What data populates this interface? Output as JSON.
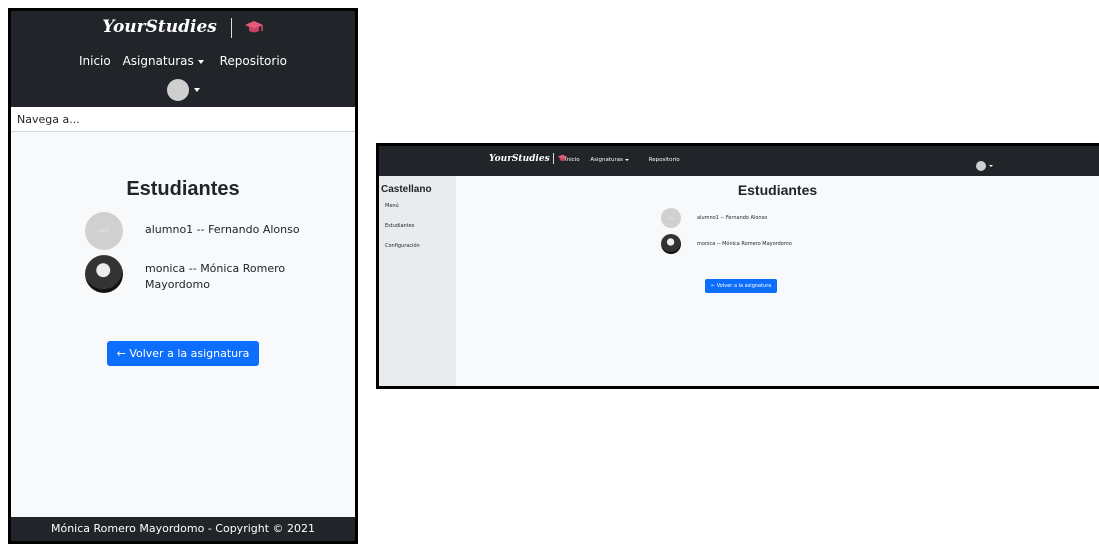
{
  "brand": "YourStudies",
  "nav": {
    "home": "Inicio",
    "subjects": "Asignaturas",
    "repository": "Repositorio"
  },
  "mobile": {
    "search_placeholder": "Navega a...",
    "page_title": "Estudiantes",
    "students": [
      {
        "label": "alumno1 -- Fernando Alonso"
      },
      {
        "label": "monica -- Mónica Romero Mayordomo"
      }
    ],
    "back_button": "← Volver a la asignatura",
    "footer": "Mónica Romero Mayordomo - Copyright © 2021"
  },
  "desktop": {
    "sidebar_title": "Castellano",
    "sidebar_items": [
      "Menú",
      "Estudiantes",
      "Configuración"
    ],
    "page_title": "Estudiantes",
    "students": [
      {
        "label": "alumno1 -- Fernando Alonso"
      },
      {
        "label": "monica -- Mónica Romero Mayordomo"
      }
    ],
    "back_button": "← Volver a la asignatura"
  },
  "colors": {
    "header": "#212529",
    "primary": "#0d6efd",
    "background": "#f8f9fa",
    "sidebar": "#e9ecef",
    "cap": "#e85a7a"
  }
}
